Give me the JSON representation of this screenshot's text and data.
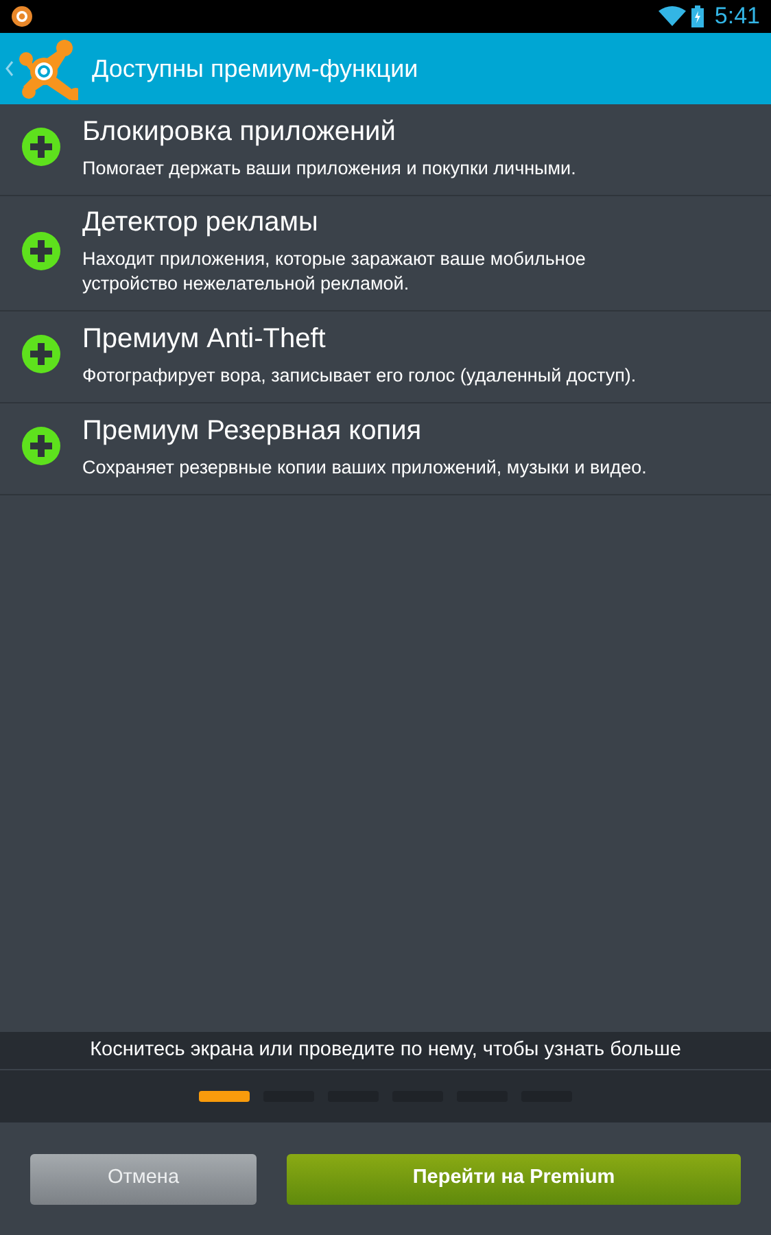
{
  "status_bar": {
    "time": "5:41"
  },
  "action_bar": {
    "title": "Доступны премиум-функции"
  },
  "features": [
    {
      "title": "Блокировка приложений",
      "description": "Помогает держать ваши приложения и покупки личными."
    },
    {
      "title": "Детектор рекламы",
      "description": "Находит приложения, которые заражают ваше мобильное устройство нежелательной рекламой."
    },
    {
      "title": "Премиум Anti-Theft",
      "description": "Фотографирует вора, записывает его голос (удаленный доступ)."
    },
    {
      "title": "Премиум Резервная копия",
      "description": "Сохраняет резервные копии ваших приложений, музыки и видео."
    }
  ],
  "hint": "Коснитесь экрана или проведите по нему, чтобы узнать больше",
  "pages": [
    {
      "selected": true
    },
    {
      "selected": false
    },
    {
      "selected": false
    },
    {
      "selected": false
    },
    {
      "selected": false
    },
    {
      "selected": false
    }
  ],
  "buttons": [
    {
      "kind": "cancel",
      "label": "Отмена"
    },
    {
      "kind": "primary",
      "label": "Перейти на Premium"
    }
  ]
}
